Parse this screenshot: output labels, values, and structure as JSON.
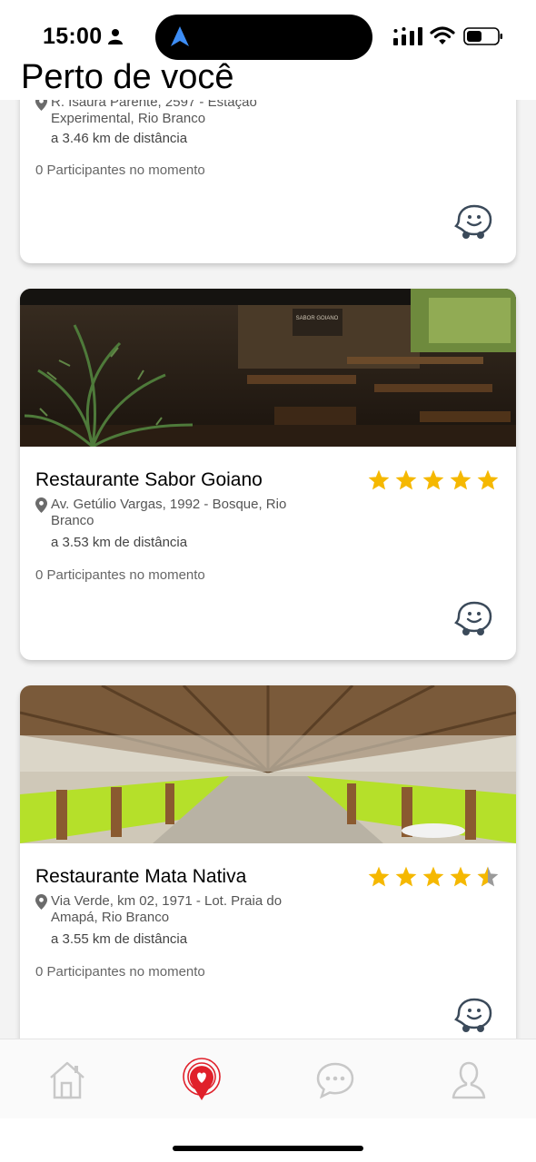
{
  "status_bar": {
    "time": "15:00"
  },
  "header": {
    "title": "Perto de você"
  },
  "cards": [
    {
      "name": "",
      "address": "R. Isaura Parente, 2597 - Estação Experimental, Rio Branco",
      "distance": "a 3.46 km de distância",
      "participants": "0 Participantes no momento",
      "rating": null
    },
    {
      "name": "Restaurante Sabor Goiano",
      "address": "Av. Getúlio Vargas, 1992 - Bosque, Rio Branco",
      "distance": "a 3.53 km de distância",
      "participants": "0 Participantes no momento",
      "rating": 5,
      "image_sign": "RESTAURANTE SABOR GOIANO"
    },
    {
      "name": "Restaurante Mata Nativa",
      "address": "Via Verde, km 02, 1971 - Lot. Praia do Amapá, Rio Branco",
      "distance": "a 3.55 km de distância",
      "participants": "0 Participantes no momento",
      "rating": 4.5
    }
  ],
  "bottom_nav": {
    "items": [
      {
        "icon": "home-icon",
        "active": false
      },
      {
        "icon": "location-heart-icon",
        "active": true
      },
      {
        "icon": "chat-icon",
        "active": false
      },
      {
        "icon": "profile-icon",
        "active": false
      }
    ]
  },
  "colors": {
    "star": "#f5b800",
    "active_nav": "#e0202a",
    "inactive_nav": "#c8c8c8",
    "waze_icon": "#3b4a5a"
  }
}
